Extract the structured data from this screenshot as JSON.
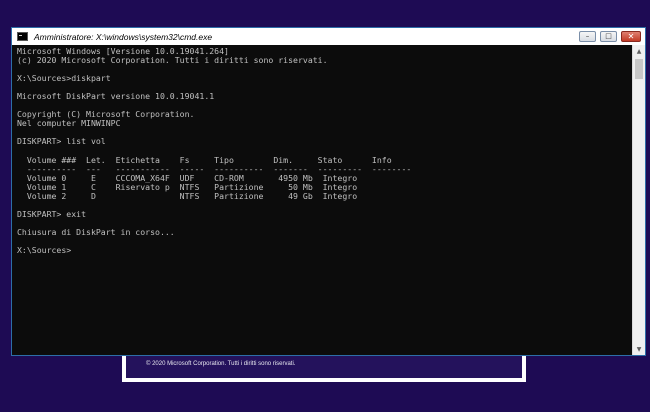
{
  "window": {
    "title": "Amministratore: X:\\windows\\system32\\cmd.exe",
    "minimize_glyph": "–",
    "maximize_glyph": "□",
    "close_glyph": "✕"
  },
  "console_lines": [
    "Microsoft Windows [Versione 10.0.19041.264]",
    "(c) 2020 Microsoft Corporation. Tutti i diritti sono riservati.",
    "",
    "X:\\Sources>diskpart",
    "",
    "Microsoft DiskPart versione 10.0.19041.1",
    "",
    "Copyright (C) Microsoft Corporation.",
    "Nel computer MINWINPC",
    "",
    "DISKPART> list vol",
    "",
    "  Volume ###  Let.  Etichetta    Fs     Tipo        Dim.     Stato      Info",
    "  ----------  ---   -----------  -----  ----------  -------  ---------  --------",
    "  Volume 0     E    CCCOMA_X64F  UDF    CD-ROM       4950 Mb  Integro",
    "  Volume 1     C    Riservato p  NTFS   Partizione     50 Mb  Integro",
    "  Volume 2     D                 NTFS   Partizione     49 Gb  Integro",
    "",
    "DISKPART> exit",
    "",
    "Chiusura di DiskPart in corso...",
    "",
    "X:\\Sources>"
  ],
  "background_dialog": {
    "copyright": "© 2020 Microsoft Corporation. Tutti i diritti sono riservati."
  },
  "colors": {
    "desktop": "#1e0b54",
    "console_bg": "#0c0c0c",
    "console_text": "#c0c0c0",
    "close_button": "#c23a26"
  },
  "scrollbar": {
    "up_glyph": "▲",
    "down_glyph": "▼"
  }
}
